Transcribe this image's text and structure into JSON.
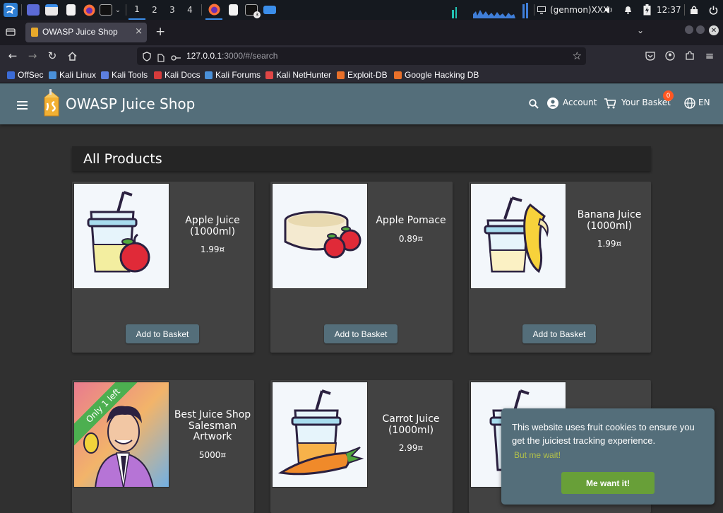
{
  "taskbar": {
    "workspaces": [
      "1",
      "2",
      "3",
      "4"
    ],
    "active_workspace": "1",
    "tray_user": "(genmon)XXX",
    "clock": "12:37",
    "terminal_badge": "3"
  },
  "browser": {
    "tab_title": "OWASP Juice Shop",
    "tab_close": "×",
    "new_tab": "+",
    "url_host": "127.0.0.1",
    "url_rest": ":3000/#/search",
    "bookmarks": [
      {
        "label": "OffSec",
        "color": "#3b6bd6"
      },
      {
        "label": "Kali Linux",
        "color": "#4a90d9"
      },
      {
        "label": "Kali Tools",
        "color": "#5c7fe0"
      },
      {
        "label": "Kali Docs",
        "color": "#d63b3b"
      },
      {
        "label": "Kali Forums",
        "color": "#4a90d9"
      },
      {
        "label": "Kali NetHunter",
        "color": "#e04646"
      },
      {
        "label": "Exploit-DB",
        "color": "#e8702a"
      },
      {
        "label": "Google Hacking DB",
        "color": "#e8702a"
      }
    ]
  },
  "app": {
    "title": "OWASP Juice Shop",
    "account_label": "Account",
    "basket_label": "Your Basket",
    "basket_count": "0",
    "language": "EN"
  },
  "main": {
    "section_title": "All Products",
    "products": [
      {
        "name": "Apple Juice (1000ml)",
        "price": "1.99¤",
        "button": "Add to Basket",
        "image": "apple-juice"
      },
      {
        "name": "Apple Pomace",
        "price": "0.89¤",
        "button": "Add to Basket",
        "image": "apple-pomace"
      },
      {
        "name": "Banana Juice (1000ml)",
        "price": "1.99¤",
        "button": "Add to Basket",
        "image": "banana-juice"
      },
      {
        "name": "Best Juice Shop Salesman Artwork",
        "price": "5000¤",
        "image": "salesman-artwork",
        "ribbon": "Only 1 left"
      },
      {
        "name": "Carrot Juice (1000ml)",
        "price": "2.99¤",
        "image": "carrot-juice"
      },
      {
        "name": "",
        "price": "",
        "image": "juice-cup"
      }
    ]
  },
  "cookie": {
    "message": "This website uses fruit cookies to ensure you get the juiciest tracking experience.",
    "link": "But me wait!",
    "button": "Me want it!"
  },
  "colors": {
    "toolbar": "#546e7a",
    "background": "#303030",
    "card": "#424242",
    "ribbon": "#4caf50",
    "cookie_button": "#689f38",
    "badge": "#ff5722"
  }
}
